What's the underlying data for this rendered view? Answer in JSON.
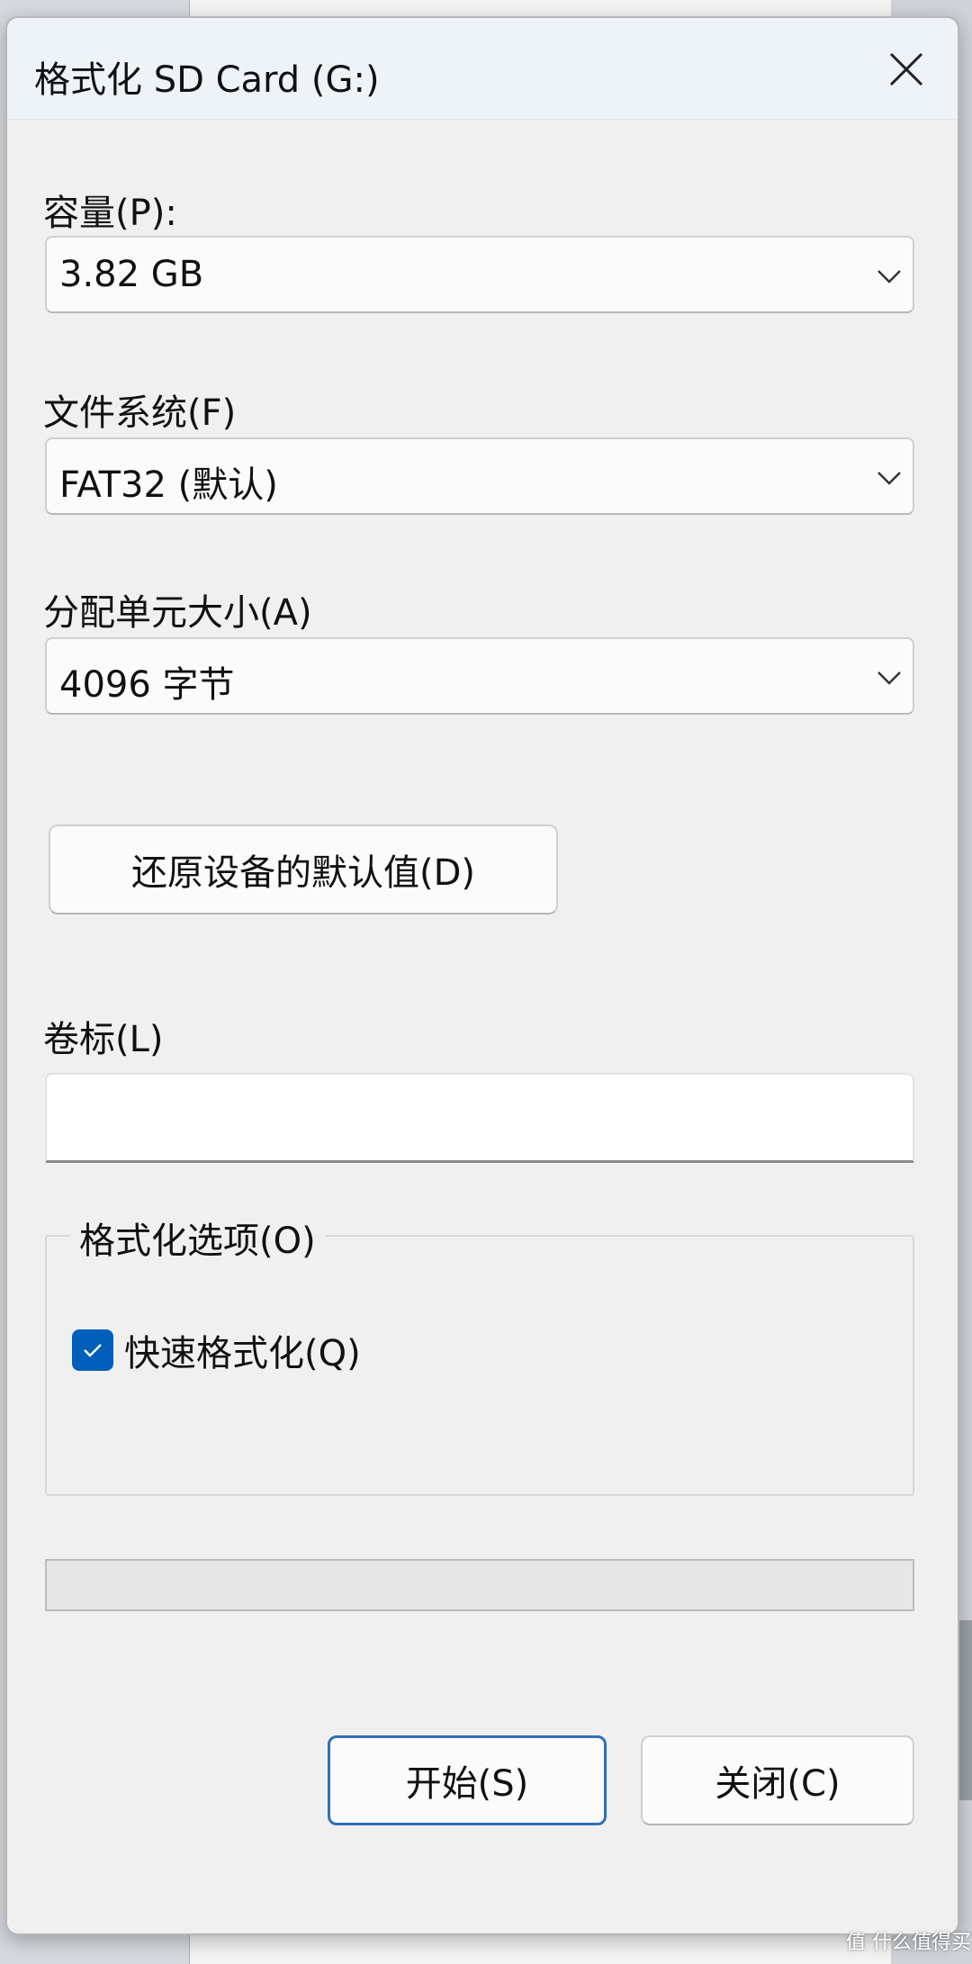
{
  "dialog": {
    "title": "格式化 SD Card (G:)",
    "close_icon": "close-icon"
  },
  "capacity": {
    "label": "容量(P):",
    "value": "3.82 GB"
  },
  "file_system": {
    "label": "文件系统(F)",
    "value": "FAT32 (默认)"
  },
  "allocation_unit": {
    "label": "分配单元大小(A)",
    "value": "4096 字节"
  },
  "restore_button": {
    "label": "还原设备的默认值(D)"
  },
  "volume_label": {
    "label": "卷标(L)",
    "value": ""
  },
  "format_options": {
    "legend": "格式化选项(O)",
    "quick_format": {
      "label": "快速格式化(Q)",
      "checked": true
    }
  },
  "progress": {
    "value_percent": 0
  },
  "buttons": {
    "start": "开始(S)",
    "close": "关闭(C)"
  },
  "watermark": "值 什么值得买",
  "colors": {
    "accent": "#005fb8",
    "dialog_bg": "#f0f0f0",
    "titlebar_bg": "#eef3f8"
  }
}
